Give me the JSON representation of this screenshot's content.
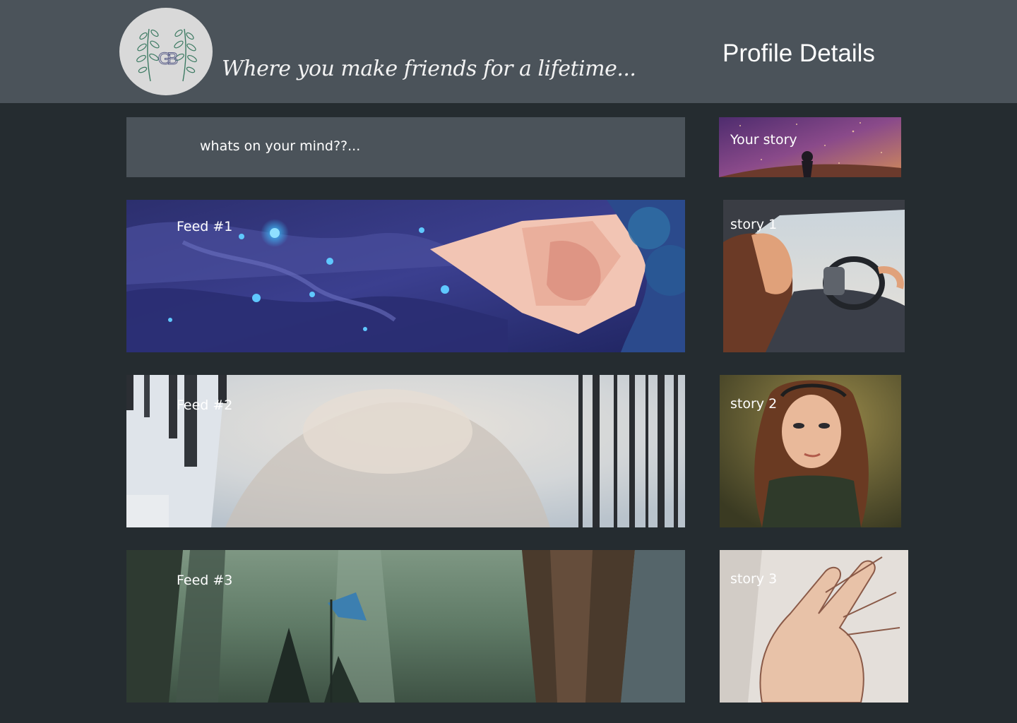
{
  "header": {
    "logo_text": "GB",
    "tagline": "Where you make friends for a lifetime...",
    "profile_link": "Profile Details"
  },
  "composer": {
    "placeholder": "whats on your mind??..."
  },
  "feeds": [
    {
      "label": "Feed #1"
    },
    {
      "label": "Feed #2"
    },
    {
      "label": "Feed #3"
    }
  ],
  "stories": {
    "own": {
      "label": "Your story"
    },
    "items": [
      {
        "label": "story 1"
      },
      {
        "label": "story 2"
      },
      {
        "label": "story 3"
      }
    ]
  },
  "colors": {
    "page_background": "#252c30",
    "header_background": "#4b535a",
    "composer_background": "#4b535a",
    "logo_background": "#d9d9d9",
    "text": "#ffffff"
  }
}
